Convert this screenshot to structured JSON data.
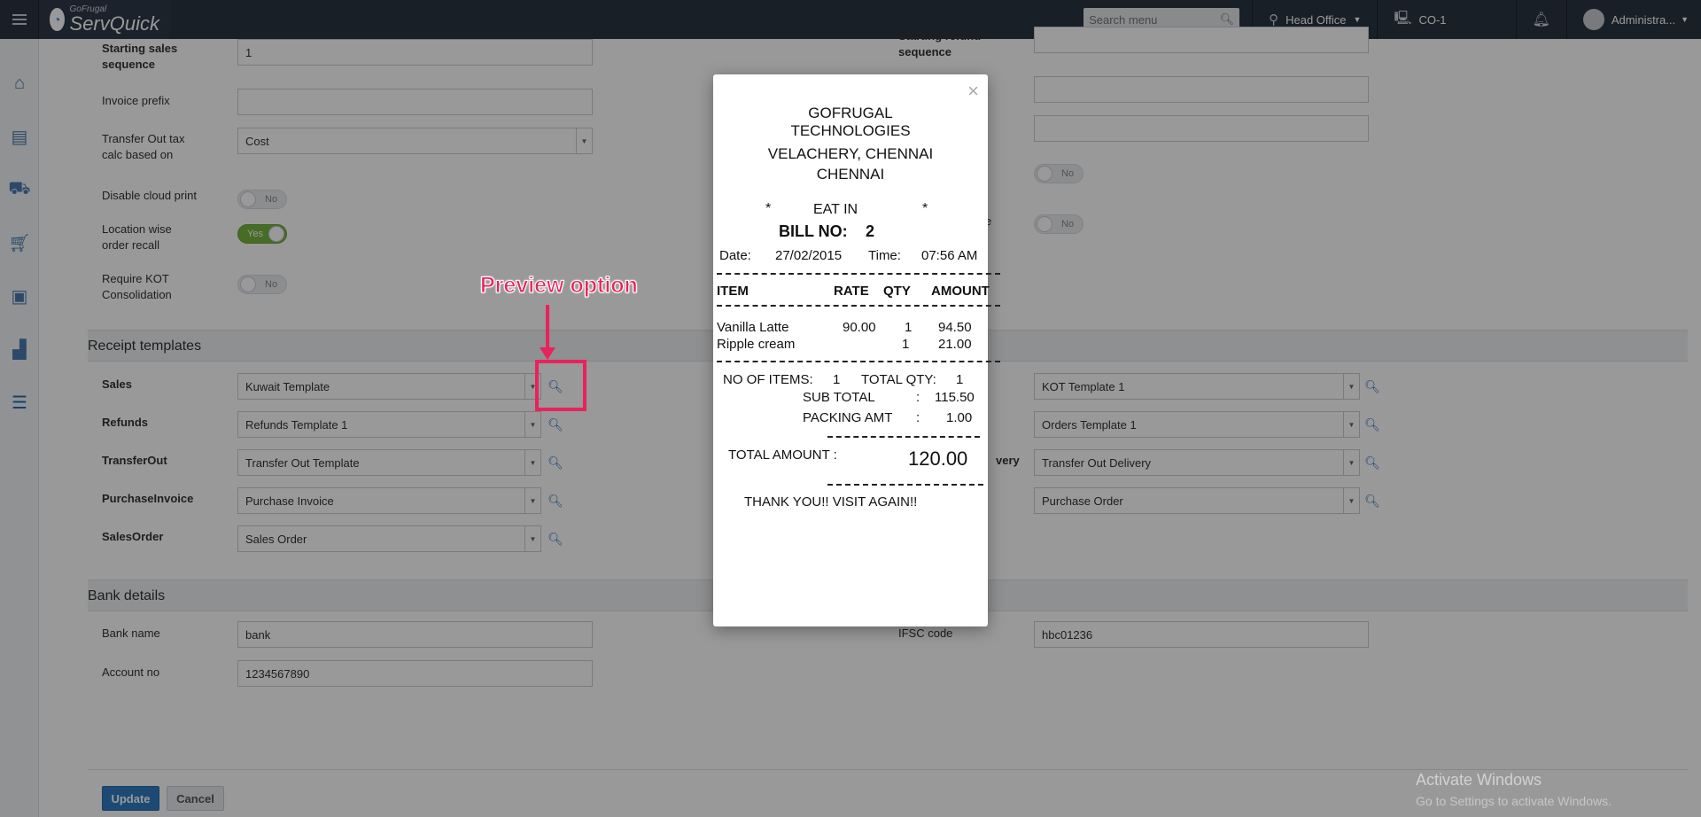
{
  "app": {
    "brand_small": "GoFrugal",
    "brand_big": "ServQuick",
    "search_placeholder": "Search menu",
    "location": "Head Office",
    "counter": "CO-1",
    "user": "Administra..."
  },
  "sidebar": {
    "icons": [
      "home-icon",
      "book-icon",
      "hand-truck-icon",
      "cart-icon",
      "box-icon",
      "bar-chart-icon",
      "sliders-icon"
    ]
  },
  "form_top": {
    "starting_sales_sequence_label": "Starting sales sequence",
    "starting_sales_sequence_value": "1",
    "invoice_prefix_label": "Invoice prefix",
    "invoice_prefix_value": "",
    "transfer_out_tax_label": "Transfer Out tax calc based on",
    "transfer_out_tax_value": "Cost",
    "disable_cloud_print_label": "Disable cloud print",
    "disable_cloud_print_value": "No",
    "location_wise_recall_label": "Location wise order recall",
    "location_wise_recall_value": "Yes",
    "require_kot_label": "Require KOT Consolidation",
    "require_kot_value": "No",
    "right_seq_label": "Starting refund sequence",
    "right_toggle1_value": "No",
    "right_toggle2_value": "No",
    "right_partial_label": "e"
  },
  "receipt_templates": {
    "title": "Receipt templates",
    "left": [
      {
        "label": "Sales",
        "value": "Kuwait Template"
      },
      {
        "label": "Refunds",
        "value": "Refunds Template 1"
      },
      {
        "label": "TransferOut",
        "value": "Transfer Out Template"
      },
      {
        "label": "PurchaseInvoice",
        "value": "Purchase Invoice"
      },
      {
        "label": "SalesOrder",
        "value": "Sales Order"
      }
    ],
    "right": [
      {
        "label": "",
        "value": "KOT Template 1"
      },
      {
        "label": "",
        "value": "Orders Template 1"
      },
      {
        "label": "very",
        "value": "Transfer Out Delivery"
      },
      {
        "label": "",
        "value": "Purchase Order"
      }
    ]
  },
  "bank_details": {
    "title": "Bank details",
    "bank_name_label": "Bank name",
    "bank_name_value": "bank",
    "account_no_label": "Account no",
    "account_no_value": "1234567890",
    "ifsc_label": "IFSC code",
    "ifsc_value": "hbc01236"
  },
  "actions": {
    "update": "Update",
    "cancel": "Cancel"
  },
  "annotation": {
    "text": "Preview option"
  },
  "watermark": {
    "line1": "Activate Windows",
    "line2": "Go to Settings to activate Windows."
  },
  "receipt": {
    "close": "×",
    "company1": "GOFRUGAL",
    "company2": "TECHNOLOGIES",
    "address1": "VELACHERY, CHENNAI",
    "address2": "CHENNAI",
    "star": "*",
    "order_type": "EAT IN",
    "bill_no_label": "BILL NO:",
    "bill_no": "2",
    "date_label": "Date:",
    "date": "27/02/2015",
    "time_label": "Time:",
    "time": "07:56 AM",
    "col_item": "ITEM",
    "col_rate": "RATE",
    "col_qty": "QTY",
    "col_amount": "AMOUNT",
    "items": [
      {
        "name": "Vanilla Latte",
        "rate": "90.00",
        "qty": "1",
        "amount": "94.50"
      },
      {
        "name": "Ripple cream",
        "rate": "",
        "qty": "1",
        "amount": "21.00"
      }
    ],
    "no_of_items_label": "NO OF ITEMS:",
    "no_of_items": "1",
    "total_qty_label": "TOTAL QTY:",
    "total_qty": "1",
    "sub_total_label": "SUB TOTAL",
    "sub_total": "115.50",
    "packing_label": "PACKING AMT",
    "packing": "1.00",
    "colon": ":",
    "total_label": "TOTAL AMOUNT :",
    "total": "120.00",
    "thanks": "THANK YOU!! VISIT AGAIN!!"
  }
}
